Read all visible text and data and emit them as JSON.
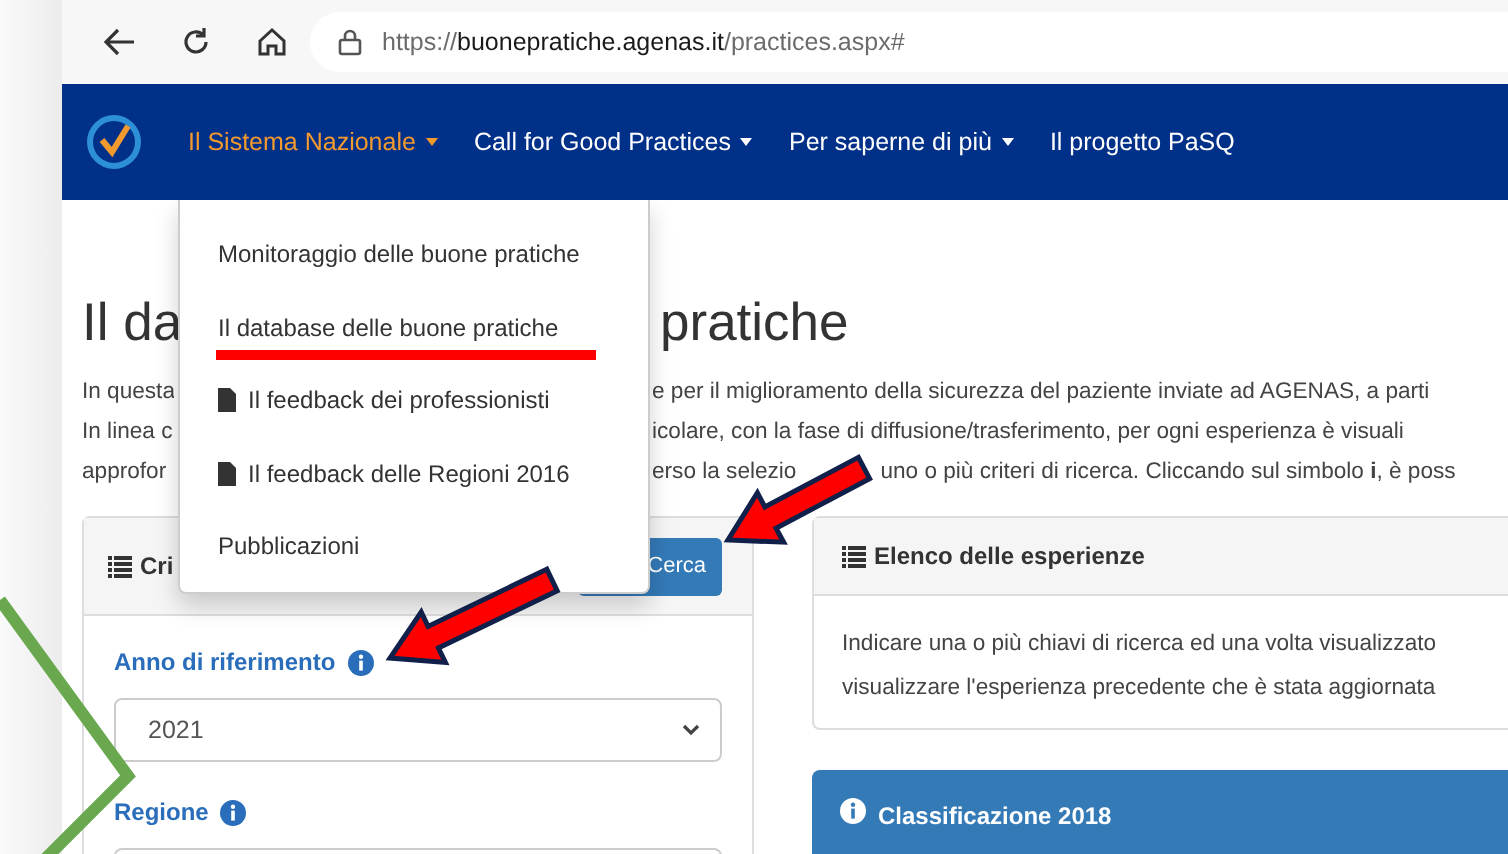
{
  "browser": {
    "url_scheme": "https://",
    "url_host": "buonepratiche.agenas.it",
    "url_path": "/practices.aspx#"
  },
  "navbar": {
    "items": [
      {
        "label": "Il Sistema Nazionale",
        "selected": true,
        "caret": true
      },
      {
        "label": "Call for Good Practices",
        "selected": false,
        "caret": true
      },
      {
        "label": "Per saperne di più",
        "selected": false,
        "caret": true
      },
      {
        "label": "Il progetto PaSQ",
        "selected": false,
        "caret": false
      }
    ]
  },
  "dropdown": {
    "items": [
      {
        "label": "Monitoraggio delle buone pratiche",
        "kind": "link"
      },
      {
        "label": "Il database delle buone pratiche",
        "kind": "link"
      },
      {
        "label": "Il feedback dei professionisti",
        "kind": "document"
      },
      {
        "label": "Il feedback delle Regioni 2016",
        "kind": "document"
      },
      {
        "label": "Pubblicazioni",
        "kind": "link"
      }
    ]
  },
  "heading": {
    "start": "Il da",
    "end": "pratiche"
  },
  "intro": {
    "lines": [
      {
        "start": "In questa",
        "end": [
          "e per il miglioramento della sicurezza del paziente inviate ad AGENAS, a parti"
        ]
      },
      {
        "start": "In linea c",
        "end": [
          "icolare, con la fase di diffusione/trasferimento, per ogni esperienza è visuali"
        ]
      },
      {
        "start": "approfor",
        "end": [
          "erso la selezio",
          "uno o più criteri di ricerca. Cliccando sul simbolo **i**, è poss"
        ]
      }
    ]
  },
  "criteria_card": {
    "title": "Cri",
    "button": "Cerca",
    "fields": [
      {
        "label": "Anno di riferimento",
        "kind": "select",
        "value": "2021"
      },
      {
        "label": "Regione",
        "kind": "input"
      }
    ]
  },
  "list_card": {
    "title": "Elenco delle esperienze",
    "text": [
      "Indicare una o più chiavi di ricerca ed una volta visualizzato",
      "visualizzare l'esperienza precedente che è stata aggiornata"
    ]
  },
  "class_card": {
    "title": "Classificazione 2018"
  },
  "annotations": [
    {
      "kind": "underline"
    },
    {
      "kind": "arrow"
    },
    {
      "kind": "arrow"
    },
    {
      "kind": "chevron"
    }
  ]
}
